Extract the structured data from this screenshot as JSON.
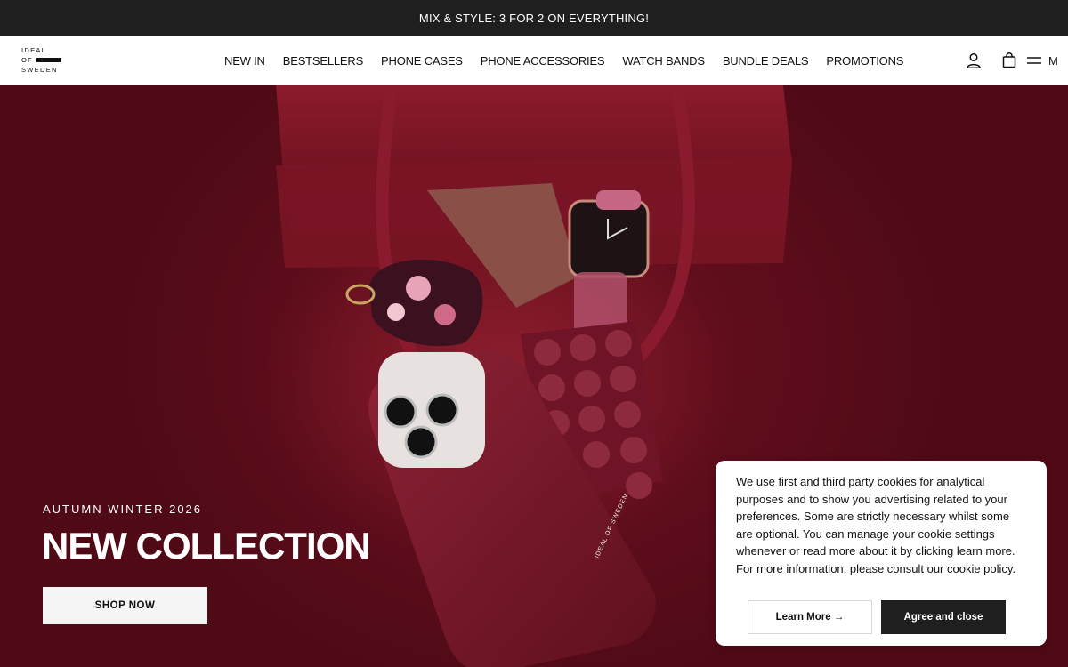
{
  "promo": {
    "text": "MIX & STYLE: 3 FOR 2 ON EVERYTHING!"
  },
  "logo": {
    "line1": "IDEAL",
    "line2": "OF",
    "line3": "SWEDEN"
  },
  "nav": {
    "items": [
      {
        "label": "NEW IN"
      },
      {
        "label": "BESTSELLERS"
      },
      {
        "label": "PHONE CASES"
      },
      {
        "label": "PHONE ACCESSORIES"
      },
      {
        "label": "WATCH BANDS"
      },
      {
        "label": "BUNDLE DEALS"
      },
      {
        "label": "PROMOTIONS"
      }
    ]
  },
  "header": {
    "icons": [
      "account-icon",
      "bag-icon",
      "menu-icon"
    ],
    "menu_label": "M"
  },
  "hero": {
    "subtitle": "AUTUMN WINTER 2026",
    "title": "NEW COLLECTION",
    "cta_label": "SHOP NOW",
    "case_brand": "IDEAL OF SWEDEN",
    "bg_color": "#6e1020"
  },
  "cookie": {
    "text": "We use first and third party cookies for analytical purposes and to show you advertising related to your preferences. Some are strictly necessary whilst some are optional. You can manage your cookie settings whenever or read more about it by clicking learn more. For more information, please consult our cookie policy.",
    "learn_label": "Learn More →",
    "agree_label": "Agree and close"
  }
}
